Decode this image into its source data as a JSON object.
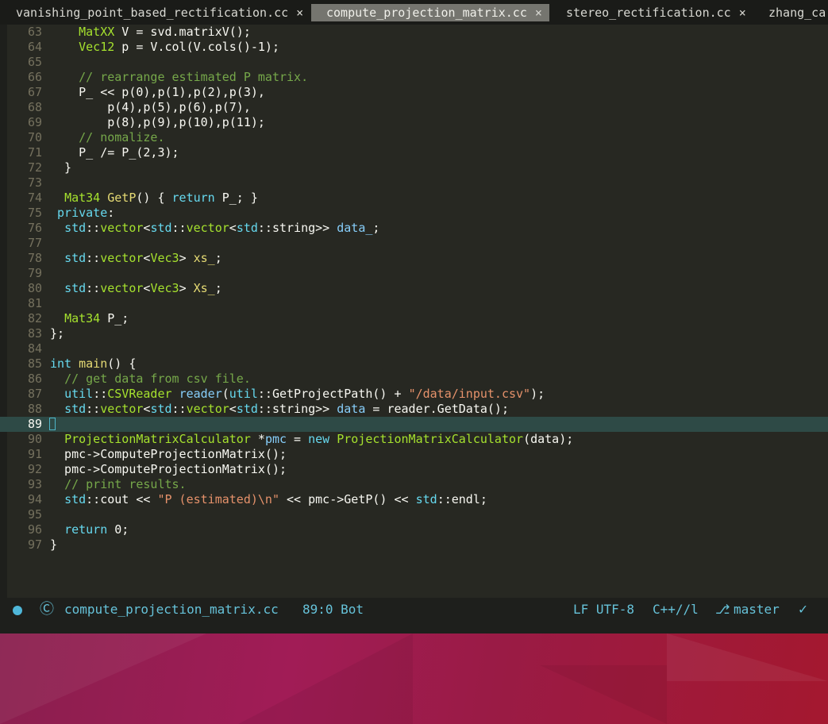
{
  "tabs": [
    {
      "label": "vanishing_point_based_rectification.cc",
      "close": "×",
      "active": false
    },
    {
      "label": "compute_projection_matrix.cc",
      "close": "×",
      "active": true
    },
    {
      "label": "stereo_rectification.cc",
      "close": "×",
      "active": false
    },
    {
      "label": "zhang_ca",
      "close": "",
      "active": false
    }
  ],
  "lines": [
    {
      "n": "63",
      "html": "    <span class='g'>MatXX</span> V = svd.matrixV();"
    },
    {
      "n": "64",
      "html": "    <span class='g'>Vec12</span> p = V.col(V.cols()-1);"
    },
    {
      "n": "65",
      "html": ""
    },
    {
      "n": "66",
      "html": "    <span class='c'>// rearrange estimated P matrix.</span>"
    },
    {
      "n": "67",
      "html": "    P_ &lt;&lt; p(0),p(1),p(2),p(3),"
    },
    {
      "n": "68",
      "html": "        p(4),p(5),p(6),p(7),"
    },
    {
      "n": "69",
      "html": "        p(8),p(9),p(10),p(11);"
    },
    {
      "n": "70",
      "html": "    <span class='c'>// nomalize.</span>"
    },
    {
      "n": "71",
      "html": "    P_ /= P_(2,3);"
    },
    {
      "n": "72",
      "html": "  }"
    },
    {
      "n": "73",
      "html": ""
    },
    {
      "n": "74",
      "html": "  <span class='g'>Mat34</span> <span class='y'>GetP</span>() { <span class='t'>return</span> P_; }"
    },
    {
      "n": "75",
      "html": " <span class='t'>private</span>:"
    },
    {
      "n": "76",
      "html": "  <span class='t'>std</span>::<span class='g'>vector</span>&lt;<span class='t'>std</span>::<span class='g'>vector</span>&lt;<span class='t'>std</span>::string&gt;&gt; <span class='v'>data_</span>;"
    },
    {
      "n": "77",
      "html": ""
    },
    {
      "n": "78",
      "html": "  <span class='t'>std</span>::<span class='g'>vector</span>&lt;<span class='g'>Vec3</span>&gt; <span class='y'>xs_</span>;"
    },
    {
      "n": "79",
      "html": ""
    },
    {
      "n": "80",
      "html": "  <span class='t'>std</span>::<span class='g'>vector</span>&lt;<span class='g'>Vec3</span>&gt; <span class='y'>Xs_</span>;"
    },
    {
      "n": "81",
      "html": ""
    },
    {
      "n": "82",
      "html": "  <span class='g'>Mat34</span> P_;"
    },
    {
      "n": "83",
      "html": "};"
    },
    {
      "n": "84",
      "html": ""
    },
    {
      "n": "85",
      "html": "<span class='t'>int</span> <span class='y'>main</span>() {"
    },
    {
      "n": "86",
      "html": "  <span class='c'>// get data from csv file.</span>"
    },
    {
      "n": "87",
      "html": "  <span class='t'>util</span>::<span class='g'>CSVReader</span> <span class='v'>reader</span>(<span class='t'>util</span>::GetProjectPath() + <span class='s'>\"/data/input.csv\"</span>);"
    },
    {
      "n": "88",
      "html": "  <span class='t'>std</span>::<span class='g'>vector</span>&lt;<span class='t'>std</span>::<span class='g'>vector</span>&lt;<span class='t'>std</span>::string&gt;&gt; <span class='v'>data</span> = reader.GetData();"
    },
    {
      "n": "89",
      "html": "",
      "current": true
    },
    {
      "n": "90",
      "html": "  <span class='g'>ProjectionMatrixCalculator</span> *<span class='v'>pmc</span> = <span class='t'>new</span> <span class='g'>ProjectionMatrixCalculator</span>(data);"
    },
    {
      "n": "91",
      "html": "  pmc-&gt;ComputeProjectionMatrix();"
    },
    {
      "n": "92",
      "html": "  pmc-&gt;ComputeProjectionMatrix();"
    },
    {
      "n": "93",
      "html": "  <span class='c'>// print results.</span>"
    },
    {
      "n": "94",
      "html": "  <span class='t'>std</span>::cout &lt;&lt; <span class='s'>\"P (estimated)\\n\"</span> &lt;&lt; pmc-&gt;GetP() &lt;&lt; <span class='t'>std</span>::endl;"
    },
    {
      "n": "95",
      "html": ""
    },
    {
      "n": "96",
      "html": "  <span class='t'>return</span> 0;"
    },
    {
      "n": "97",
      "html": "}"
    }
  ],
  "statusbar": {
    "c_icon": "Ⓒ",
    "filename": "compute_projection_matrix.cc",
    "position": "89:0 Bot",
    "encoding": "LF UTF-8",
    "mode": "C++//l",
    "branch_icon": "⎇",
    "branch": "master",
    "check": "✓"
  },
  "colors": {
    "editor_bg": "#272822",
    "current_line": "#2e4a46",
    "accent": "#66c2d9"
  }
}
